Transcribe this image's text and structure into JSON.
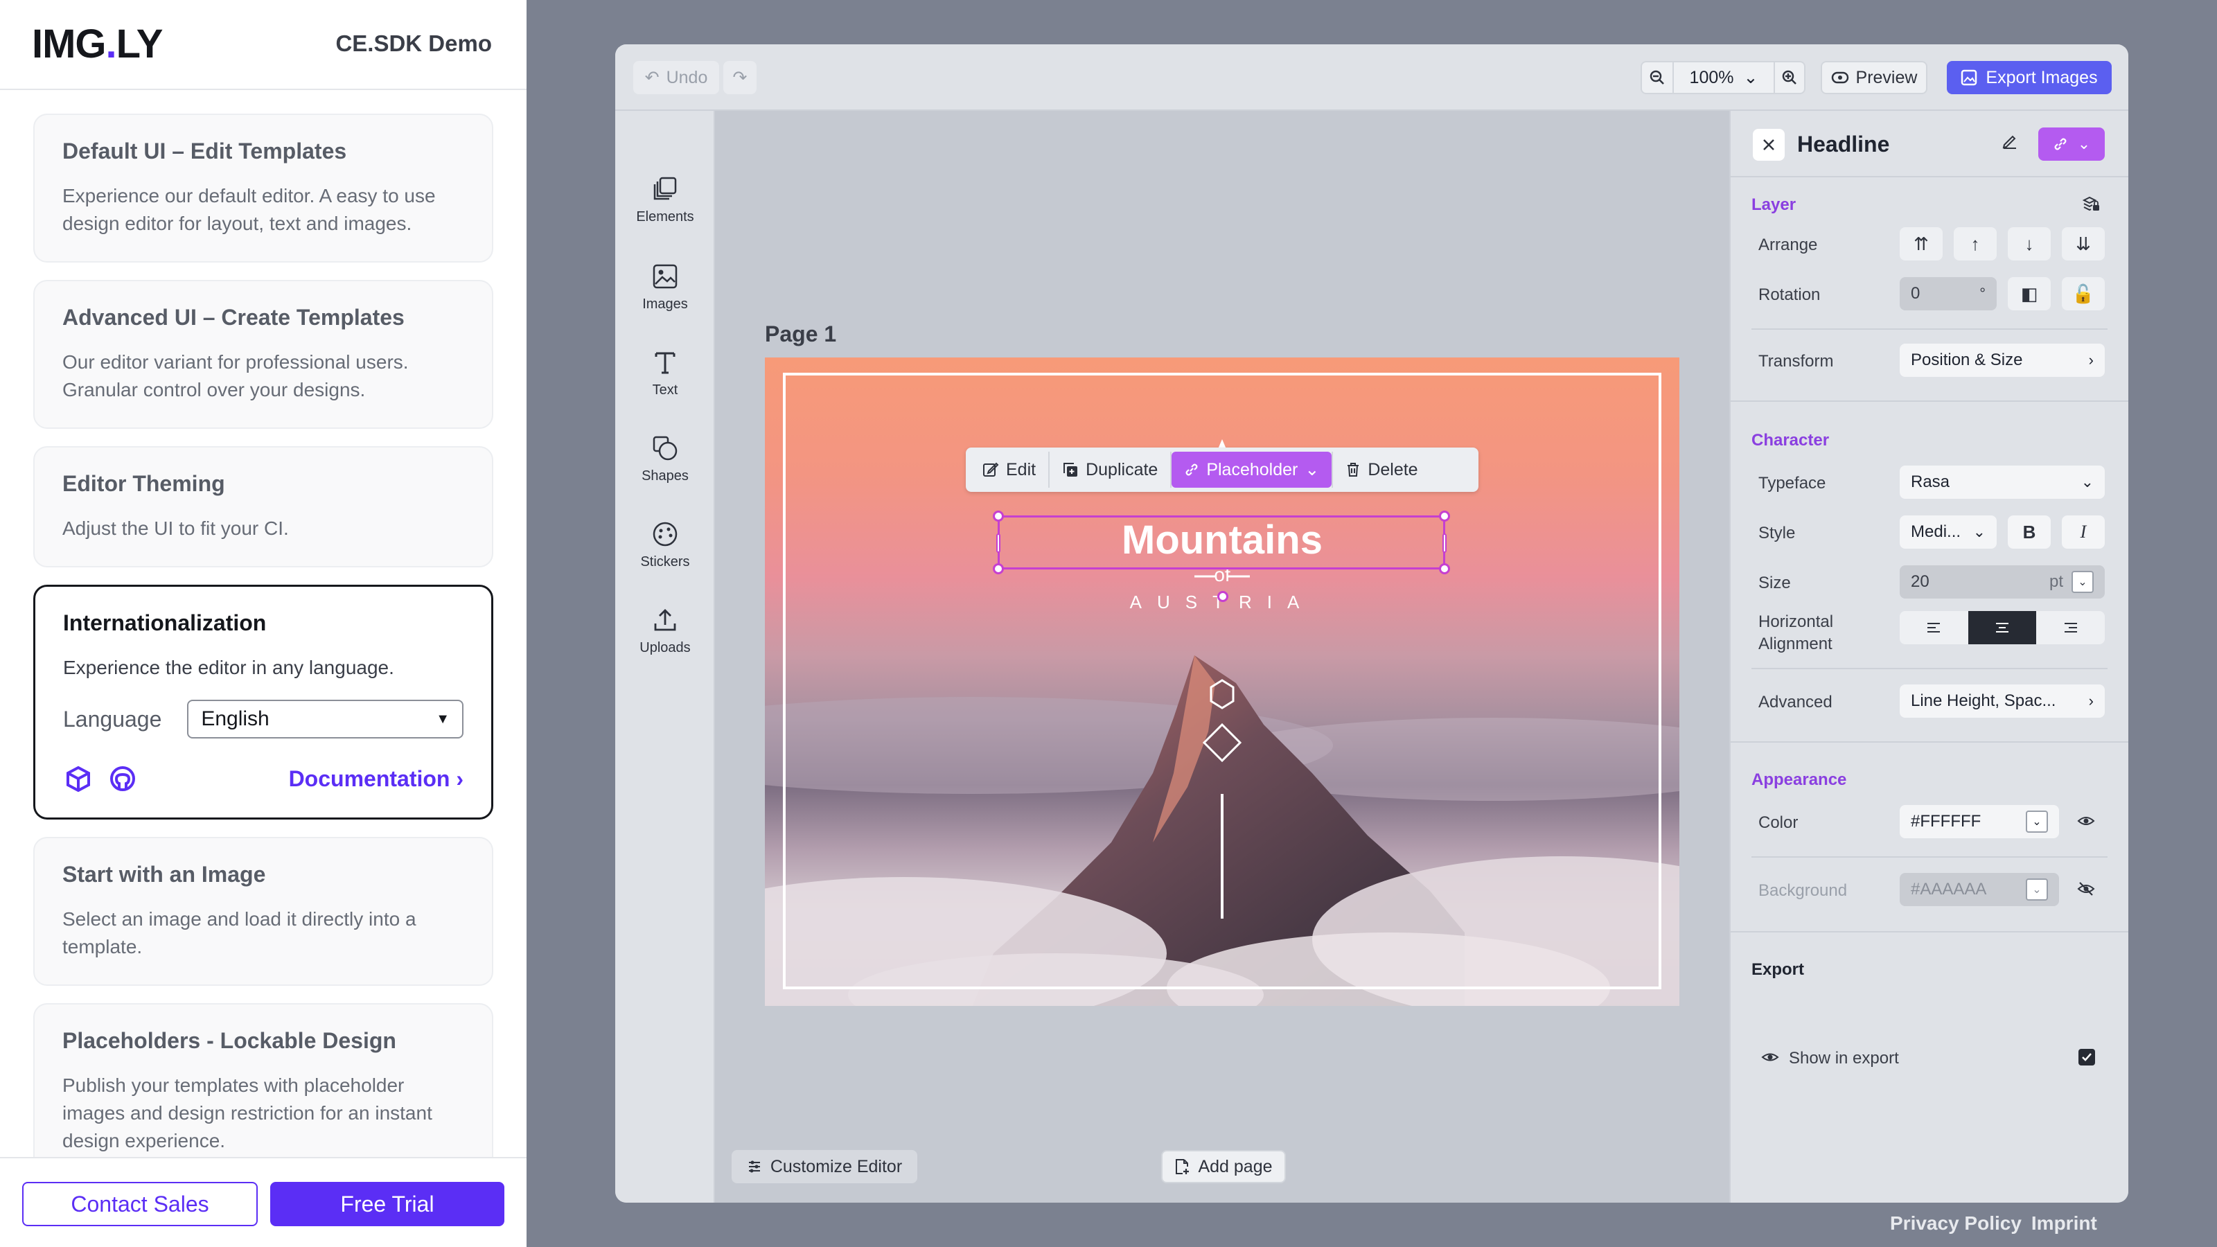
{
  "sidebar": {
    "logo_main": "IMG",
    "logo_dot": ".",
    "logo_end": "LY",
    "demo_title": "CE.SDK Demo",
    "cards": [
      {
        "title": "Default UI – Edit Templates",
        "text": "Experience our default editor. A easy to use design editor for layout, text and images."
      },
      {
        "title": "Advanced UI – Create Templates",
        "text": "Our editor variant for professional users. Granular control over your designs."
      },
      {
        "title": "Editor Theming",
        "text": "Adjust the UI to fit your CI."
      },
      {
        "title": "Internationalization",
        "text": "Experience the editor in any language."
      },
      {
        "title": "Start with an Image",
        "text": "Select an image and load it directly into a template."
      },
      {
        "title": "Placeholders - Lockable Design",
        "text": "Publish your templates with placeholder images and design restriction for an instant design experience."
      }
    ],
    "language_label": "Language",
    "language_value": "English",
    "documentation_label": "Documentation",
    "contact_sales": "Contact Sales",
    "free_trial": "Free Trial"
  },
  "topbar": {
    "undo": "Undo",
    "zoom": "100%",
    "preview": "Preview",
    "export": "Export Images"
  },
  "dock": [
    {
      "label": "Elements",
      "icon": "elements-icon"
    },
    {
      "label": "Images",
      "icon": "images-icon"
    },
    {
      "label": "Text",
      "icon": "text-icon"
    },
    {
      "label": "Shapes",
      "icon": "shapes-icon"
    },
    {
      "label": "Stickers",
      "icon": "stickers-icon"
    },
    {
      "label": "Uploads",
      "icon": "uploads-icon"
    }
  ],
  "canvas": {
    "page_label": "Page 1",
    "headline": "Mountains",
    "of_text": "of",
    "subtitle": "AUSTRIA",
    "context_menu": {
      "edit": "Edit",
      "duplicate": "Duplicate",
      "placeholder": "Placeholder",
      "delete": "Delete"
    },
    "customize_editor": "Customize Editor",
    "add_page": "Add page"
  },
  "inspector": {
    "title": "Headline",
    "layer": {
      "section": "Layer",
      "arrange": "Arrange",
      "rotation": "Rotation",
      "rotation_value": "0",
      "rotation_unit": "°",
      "transform": "Transform",
      "transform_value": "Position & Size"
    },
    "character": {
      "section": "Character",
      "typeface": "Typeface",
      "typeface_value": "Rasa",
      "style": "Style",
      "style_value": "Medi...",
      "size": "Size",
      "size_value": "20",
      "size_unit": "pt",
      "h_align_1": "Horizontal",
      "h_align_2": "Alignment",
      "advanced": "Advanced",
      "advanced_value": "Line Height, Spac..."
    },
    "appearance": {
      "section": "Appearance",
      "color": "Color",
      "color_value": "#FFFFFF",
      "background": "Background",
      "background_value": "#AAAAAA"
    },
    "export": {
      "section": "Export",
      "show_in_export": "Show in export",
      "checked": true
    }
  },
  "footer": {
    "privacy": "Privacy Policy",
    "imprint": "Imprint"
  },
  "colors": {
    "brand": "#5B2EF5",
    "accent_purple": "#B45BF0",
    "selection": "#C63FD0",
    "export_button": "#5B5FF0"
  }
}
